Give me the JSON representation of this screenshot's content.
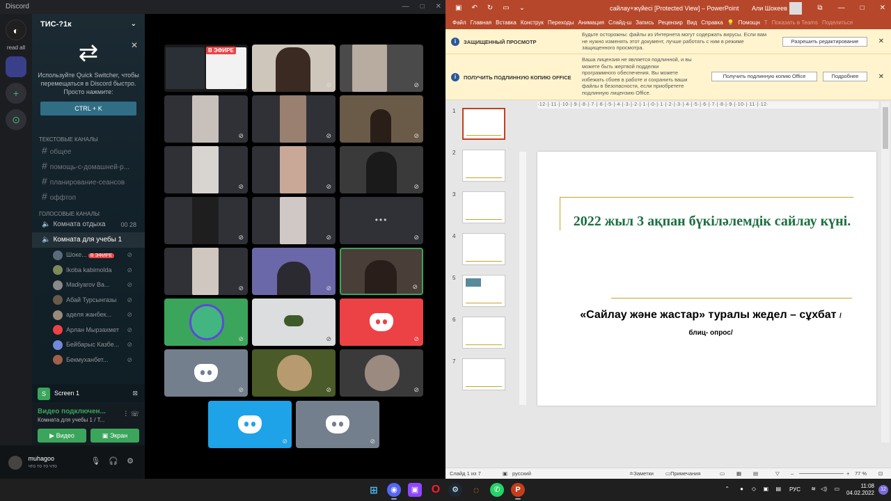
{
  "discord": {
    "app_title": "Discord",
    "server_label": "read all",
    "guild_name": "ТИС-?1к",
    "quick_switcher": {
      "text": "Используйте Quick Switcher, чтобы перемещаться в Discord быстро. Просто нажмите:",
      "shortcut": "CTRL + K"
    },
    "text_category": "ТЕКСТОВЫЕ КАНАЛЫ",
    "text_channels": [
      "общее",
      "помощь-с-домашней-р...",
      "планирование-сеансов",
      "оффтоп"
    ],
    "voice_category": "ГОЛОСОВЫЕ КАНАЛЫ",
    "voice_channels": [
      {
        "name": "Комната отдыха",
        "count": "00  28"
      },
      {
        "name": "Комната для учебы 1",
        "count": ""
      }
    ],
    "voice_users": [
      {
        "name": "Шоке...",
        "live": "В ЭФИРЕ",
        "color": "#5b6b7b"
      },
      {
        "name": "Ikoba kabimolda",
        "live": "",
        "color": "#7b8c5a"
      },
      {
        "name": "Madiyarov Ba...",
        "live": "",
        "color": "#8a8a8a"
      },
      {
        "name": "Абай Турсынгазы",
        "live": "",
        "color": "#6a5a4a"
      },
      {
        "name": "аделя жанбек...",
        "live": "",
        "color": "#9a8a7a"
      },
      {
        "name": "Арлан Мырзахмет",
        "live": "",
        "color": "#ed4245"
      },
      {
        "name": "Бейбарыс Казбе...",
        "live": "",
        "color": "#7289da"
      },
      {
        "name": "Бекмуханбет...",
        "live": "",
        "color": "#a0604a"
      }
    ],
    "screen_label": "Screen 1",
    "voice_status": "Видео подключен...",
    "voice_sub": "Комната для учебы 1 / Т...",
    "video_btn": "Видео",
    "screen_btn": "Экран",
    "username": "muhagoo",
    "user_status": "что то то что",
    "live_badge": "В ЭФИРЕ",
    "tile_colors": {
      "green": "#3ba55c",
      "white": "#dcddde",
      "red": "#ed4245",
      "gray": "#747f8d",
      "olive": "#4a5a28",
      "darkgray": "#3a3a3a",
      "blue": "#1fa3e8"
    }
  },
  "ppt": {
    "doc_title": "сайлау+жүйесі [Protected View]  –  PowerPoint",
    "user": "Али Шокеев",
    "tabs": [
      "Файл",
      "Главная",
      "Вставка",
      "Конструк",
      "Переходы",
      "Анимация",
      "Слайд-ш",
      "Запись",
      "Рецензир",
      "Вид",
      "Справка",
      "Помощн",
      "Показать в Teams",
      "Поделиться"
    ],
    "protected": {
      "heading": "ЗАЩИЩЕННЫЙ ПРОСМОТР",
      "text": "Будьте осторожны: файлы из Интернета могут содержать вирусы. Если вам не нужно изменять этот документ, лучше работать с ним в режиме защищенного просмотра.",
      "button": "Разрешить редактирование"
    },
    "license": {
      "heading": "ПОЛУЧИТЬ ПОДЛИННУЮ КОПИЮ OFFICE",
      "text": "Ваша лицензия не является подлинной, и вы можете быть жертвой подделки программного обеспечения. Вы можете избежать сбоев в работе и сохранить ваши файлы в безопасности, если приобретете подлинную лицензию Office.",
      "button1": "Получить подлинную копию Office",
      "button2": "Подробнее"
    },
    "thumb_numbers": [
      "1",
      "2",
      "3",
      "4",
      "5",
      "6",
      "7"
    ],
    "ruler": "·12·|·11·|·10·|·9·|·8·|·7·|·6·|·5·|·4·|·3·|·2·|·1·|·0·|·1·|·2·|·3·|·4·|·5·|·6·|·7·|·8·|·9·|·10·|·11·|·12·",
    "slide": {
      "title": "2022 жыл 3 ақпан бүкіләлемдік сайлау күні.",
      "subtitle": "«Сайлау және жастар»  туралы жедел – сұхбат",
      "subtitle_small": "/блиц- опрос/"
    },
    "status": {
      "slide_info": "Слайд 1 из 7",
      "language": "русский",
      "notes": "Заметки",
      "comments": "Примечания",
      "zoom": "77 %"
    },
    "colors": {
      "accent": "#b7472a",
      "title_green": "#1b6e41",
      "gold": "#c9a227"
    }
  },
  "taskbar": {
    "time": "11:08",
    "date": "04.02.2022",
    "lang": "РУС",
    "notif": "12"
  }
}
